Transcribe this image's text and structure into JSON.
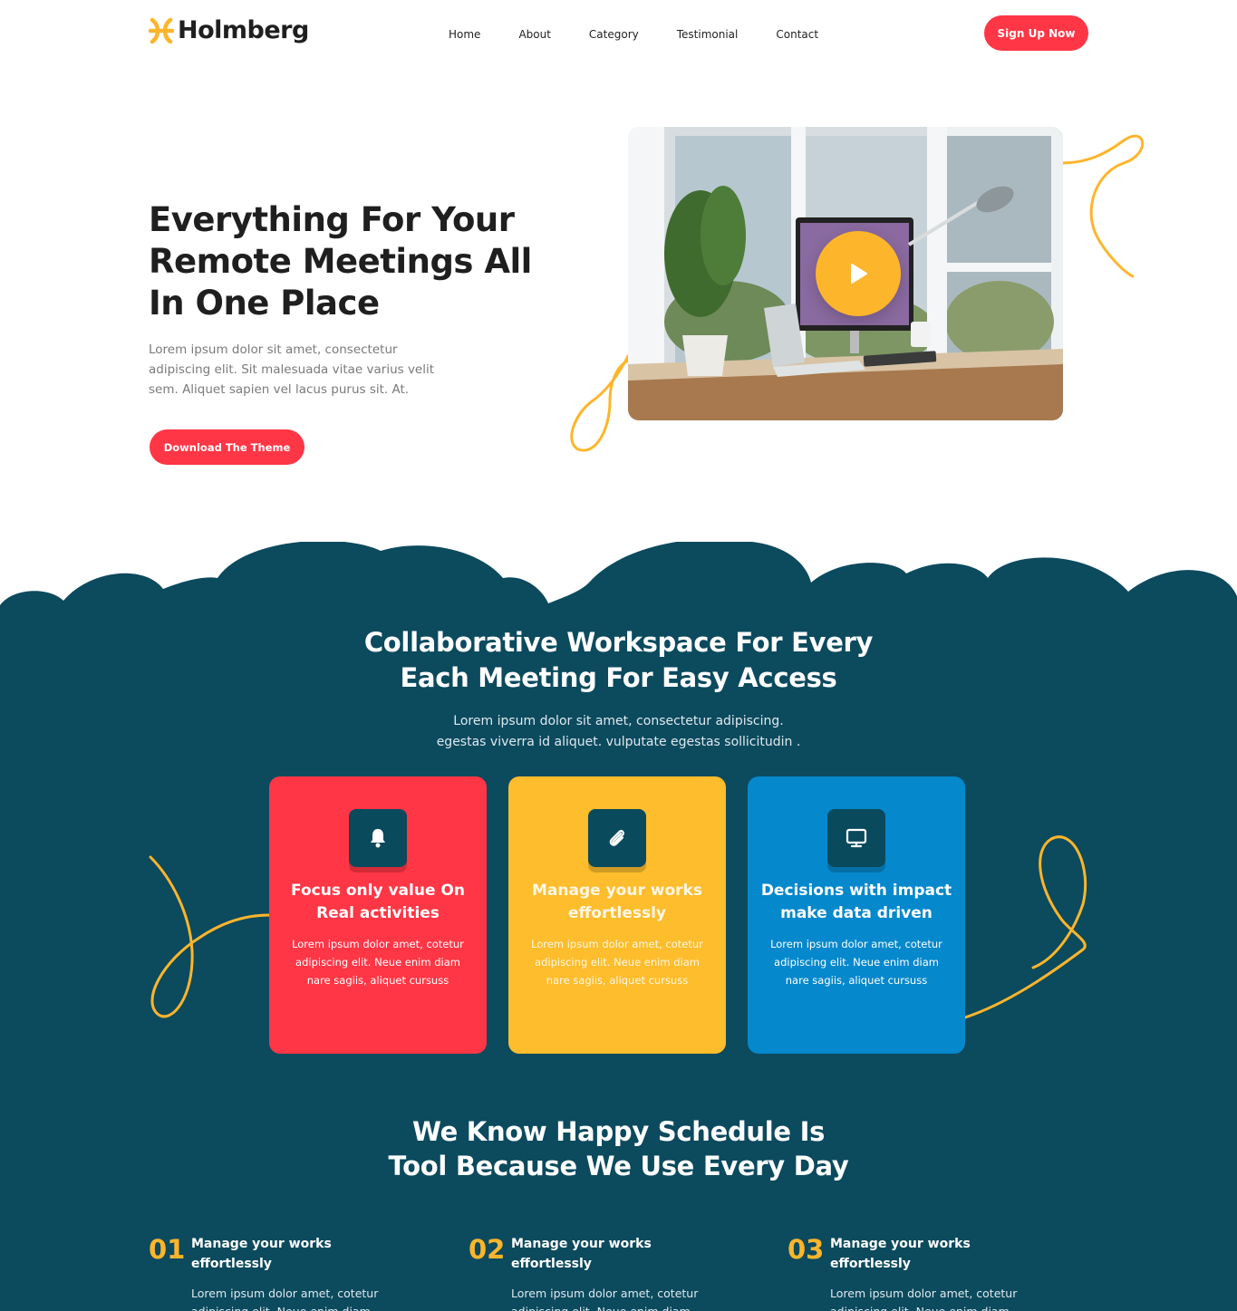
{
  "brand": {
    "name": "Holmberg",
    "accent": "#ff3645",
    "yellow": "#fdb52b",
    "dark": "#0c4a5e",
    "blue": "#0588cc"
  },
  "nav": {
    "items": [
      "Home",
      "About",
      "Category",
      "Testimonial",
      "Contact"
    ],
    "cta": "Sign Up Now"
  },
  "hero": {
    "title": "Everything For Your Remote Meetings All In One Place",
    "text": "Lorem ipsum dolor sit amet, consectetur adipiscing elit. Sit malesuada vitae varius velit sem. Aliquet sapien vel lacus purus sit. At.",
    "button": "Download The Theme",
    "image_icon": "play-icon"
  },
  "workspace": {
    "title": "Collaborative Workspace For Every Each Meeting For Easy Access",
    "text_line1": "Lorem ipsum dolor sit amet, consectetur adipiscing.",
    "text_line2": "egestas viverra id aliquet. vulputate egestas sollicitudin .",
    "cards": [
      {
        "icon": "bell-icon",
        "title": "Focus only value On Real activities",
        "text": "Lorem ipsum dolor amet, cotetur adipiscing elit. Neue enim diam nare sagiis, aliquet cursuss"
      },
      {
        "icon": "paperclip-icon",
        "title": "Manage your works effortlessly",
        "text": "Lorem ipsum dolor amet, cotetur adipiscing elit. Neue enim diam nare sagiis, aliquet cursuss"
      },
      {
        "icon": "monitor-icon",
        "title": "Decisions with impact make data driven",
        "text": "Lorem ipsum dolor amet, cotetur adipiscing elit. Neue enim diam nare sagiis, aliquet cursuss"
      }
    ]
  },
  "schedule": {
    "title": "We Know Happy Schedule Is Tool Because We Use Every Day",
    "features": [
      {
        "num": "01",
        "title": "Manage your works effortlessly",
        "text": "Lorem ipsum dolor amet, cotetur adipiscing elit. Neue enim diam"
      },
      {
        "num": "02",
        "title": "Manage your works effortlessly",
        "text": "Lorem ipsum dolor amet, cotetur adipiscing elit. Neue enim diam"
      },
      {
        "num": "03",
        "title": "Manage your works effortlessly",
        "text": "Lorem ipsum dolor amet, cotetur adipiscing elit. Neue enim diam"
      }
    ]
  }
}
